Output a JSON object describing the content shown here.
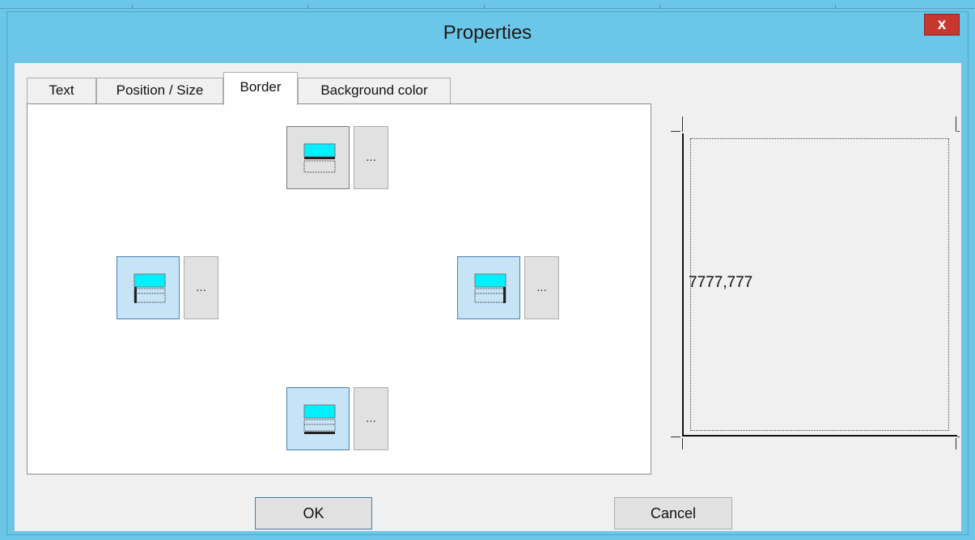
{
  "window": {
    "title": "Properties",
    "close_label": "x"
  },
  "tabs": [
    {
      "label": "Text",
      "active": false
    },
    {
      "label": "Position / Size",
      "active": false
    },
    {
      "label": "Border",
      "active": true
    },
    {
      "label": "Background color",
      "active": false
    }
  ],
  "border_panel": {
    "top": {
      "selected": false,
      "more_label": "..."
    },
    "left": {
      "selected": true,
      "more_label": "..."
    },
    "right": {
      "selected": true,
      "more_label": "..."
    },
    "bottom": {
      "selected": true,
      "more_label": "..."
    }
  },
  "preview": {
    "text": "7777,777"
  },
  "buttons": {
    "ok": "OK",
    "cancel": "Cancel"
  },
  "colors": {
    "titlebar": "#6cc6e8",
    "close": "#c7372f",
    "icon_fill": "#00f0ff",
    "selected_button": "#c7e3f6"
  }
}
